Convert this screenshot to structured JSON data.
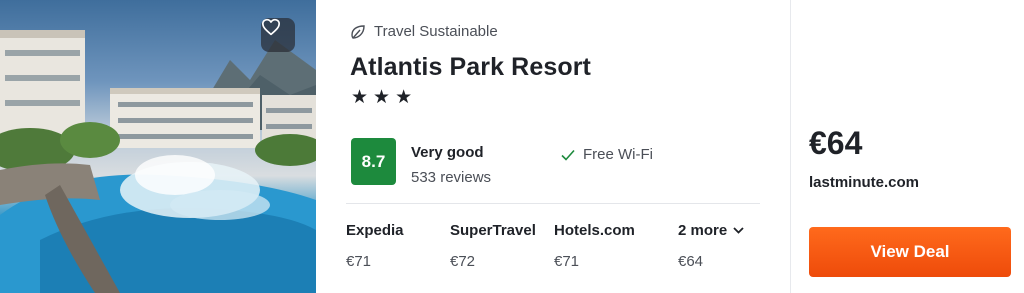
{
  "hotel": {
    "sustainability_label": "Travel Sustainable",
    "name": "Atlantis Park Resort",
    "stars": "★★★",
    "star_count": 3,
    "favorite_icon": "heart-outline-icon",
    "leaf_icon": "leaf-icon"
  },
  "rating": {
    "score": "8.7",
    "label": "Very good",
    "reviews": "533 reviews",
    "badge_color": "#1d8a3d"
  },
  "amenities": [
    {
      "label": "Free Wi-Fi",
      "icon": "checkmark-icon"
    }
  ],
  "deals": [
    {
      "provider": "Expedia",
      "price": "€71"
    },
    {
      "provider": "SuperTravel",
      "price": "€72"
    },
    {
      "provider": "Hotels.com",
      "price": "€71"
    },
    {
      "provider": "2 more",
      "price": "€64",
      "icon": "chevron-down-icon"
    }
  ],
  "best_offer": {
    "price": "€64",
    "provider": "lastminute.com",
    "button_label": "View Deal",
    "button_color": "#f05a10"
  }
}
